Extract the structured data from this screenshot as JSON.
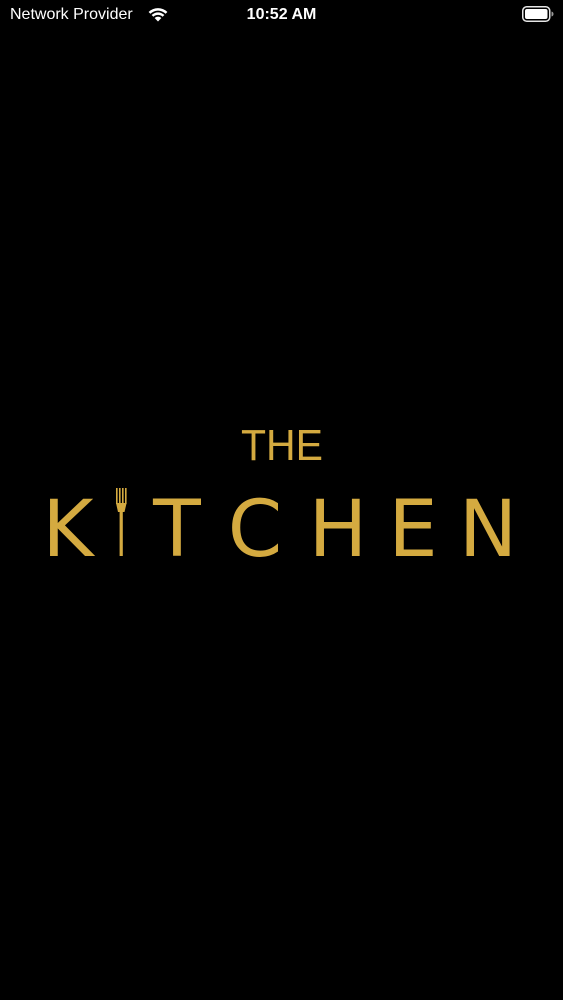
{
  "status_bar": {
    "carrier": "Network Provider",
    "time": "10:52 AM"
  },
  "logo": {
    "line1": "THE",
    "letter_k": "K",
    "letters_rest": [
      "T",
      "C",
      "H",
      "E",
      "N"
    ],
    "color": "#D4AA40"
  },
  "icons": {
    "wifi": "wifi-icon",
    "battery": "battery-icon",
    "fork": "fork-icon"
  }
}
